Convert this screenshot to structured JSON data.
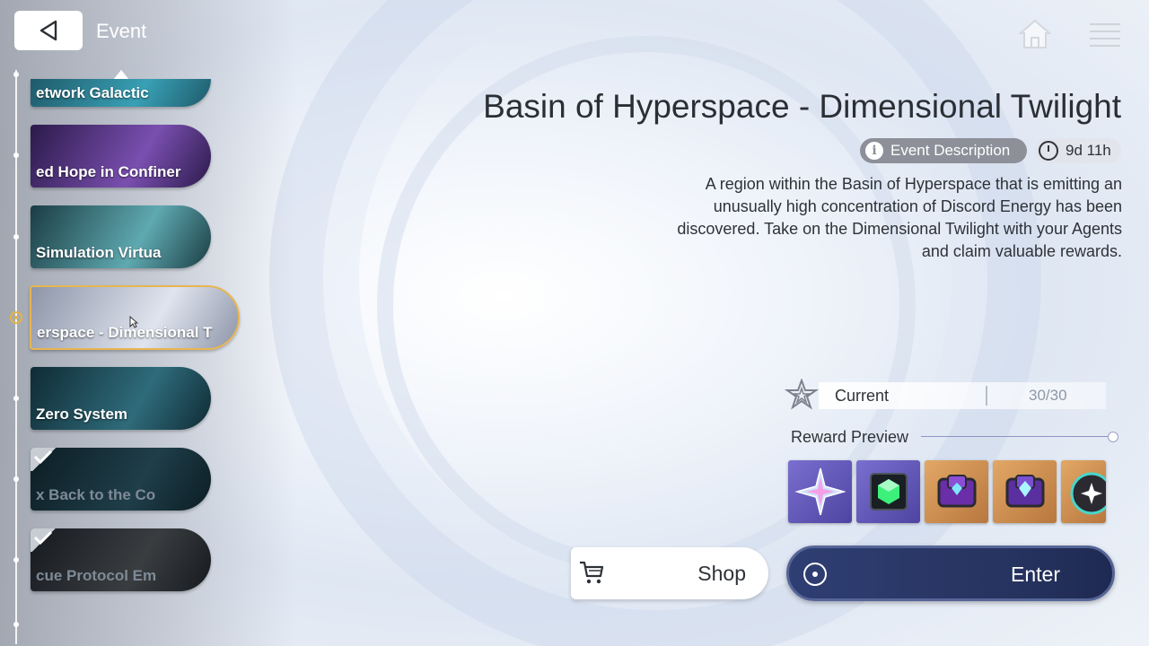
{
  "header": {
    "title": "Event",
    "back_icon": "back-triangle-icon",
    "home_icon": "home-icon",
    "menu_icon": "menu-icon"
  },
  "sidebar": {
    "cards": [
      {
        "label": "etwork       Galactic",
        "colors": [
          "#1e5a6a",
          "#39a0b5"
        ],
        "completed": false
      },
      {
        "label": "ed Hope in Confiner",
        "colors": [
          "#2b1a4a",
          "#7a4fb0"
        ],
        "completed": false
      },
      {
        "label": "Simulation      Virtua",
        "colors": [
          "#1b3c44",
          "#5fa9b0"
        ],
        "completed": false
      },
      {
        "label": "erspace - Dimensional T",
        "colors": [
          "#8d95a8",
          "#dfe4ee"
        ],
        "completed": false,
        "selected": true
      },
      {
        "label": "Zero System",
        "colors": [
          "#0f2b35",
          "#2f6b7a"
        ],
        "completed": false
      },
      {
        "label": "x      Back to the Co",
        "colors": [
          "#0c1d24",
          "#1f3e49"
        ],
        "completed": true
      },
      {
        "label": "cue Protocol      Em",
        "colors": [
          "#161a1f",
          "#3a3d40"
        ],
        "completed": true
      }
    ]
  },
  "event": {
    "title": "Basin of Hyperspace - Dimensional Twilight",
    "description_button": "Event Description",
    "timer": "9d 11h",
    "description": "A region within the Basin of Hyperspace that is emitting an unusually high concentration of Discord Energy has been discovered. Take on the Dimensional Twilight with your Agents and claim valuable rewards."
  },
  "progress": {
    "label": "Current",
    "value": "30/30"
  },
  "rewards": {
    "label": "Reward Preview",
    "items": [
      {
        "icon": "crystal-star-icon",
        "bg": "#6b5fb8"
      },
      {
        "icon": "green-cube-icon",
        "bg": "#6b5fb8"
      },
      {
        "icon": "purple-chest-icon",
        "bg": "#c98c4e"
      },
      {
        "icon": "purple-chest-icon",
        "bg": "#c98c4e"
      },
      {
        "icon": "black-orb-icon",
        "bg": "#c98c4e"
      }
    ]
  },
  "actions": {
    "shop_label": "Shop",
    "enter_label": "Enter"
  }
}
